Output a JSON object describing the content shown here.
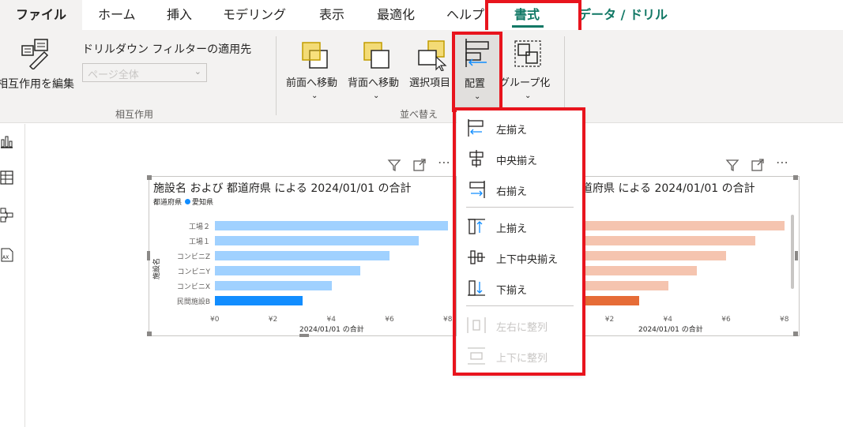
{
  "tabs": {
    "file": "ファイル",
    "home": "ホーム",
    "insert": "挿入",
    "modeling": "モデリング",
    "view": "表示",
    "optimize": "最適化",
    "help": "ヘルプ",
    "format": "書式",
    "data_drill": "データ / ドリル"
  },
  "ribbon": {
    "edit_interactions": "相互作用を編集",
    "drill_filter_label": "ドリルダウン フィルターの適用先",
    "drill_filter_value": "ページ全体",
    "group_interactions": "相互作用",
    "bring_forward": "前面へ移動",
    "send_backward": "背面へ移動",
    "selection_pane": "選択項目",
    "align": "配置",
    "group": "グループ化",
    "group_arrange": "並べ替え"
  },
  "visual_left": {
    "title": "施設名 および 都道府県 による 2024/01/01 の合計",
    "legend_label": "都道府県",
    "legend_item": "愛知県",
    "ylabel": "施設名",
    "xlabel": "2024/01/01 の合計"
  },
  "visual_right": {
    "title_visible": "道府県 による 2024/01/01 の合計",
    "xlabel": "2024/01/01 の合計"
  },
  "menu": {
    "align_left": "左揃え",
    "align_center": "中央揃え",
    "align_right": "右揃え",
    "align_top": "上揃え",
    "align_middle": "上下中央揃え",
    "align_bottom": "下揃え",
    "distribute_h": "左右に整列",
    "distribute_v": "上下に整列"
  },
  "colors": {
    "accent": "#117865",
    "annotation": "#e8141d",
    "bar_left": "#a0d1ff",
    "bar_left_highlight": "#118dff",
    "bar_right": "#f5c4af",
    "bar_right_highlight": "#e66c37"
  },
  "chart_data": [
    {
      "type": "bar",
      "orientation": "horizontal",
      "title": "施設名 および 都道府県 による 2024/01/01 の合計",
      "xlabel": "2024/01/01 の合計",
      "ylabel": "施設名",
      "categories": [
        "工場２",
        "工場１",
        "コンビニZ",
        "コンビニY",
        "コンビニX",
        "民間施設B"
      ],
      "values": [
        8,
        7,
        6,
        5,
        4,
        3
      ],
      "highlight_index": 5,
      "xticks": [
        "¥0",
        "¥2",
        "¥4",
        "¥6",
        "¥8"
      ],
      "xlim": [
        0,
        8
      ]
    },
    {
      "type": "bar",
      "orientation": "horizontal",
      "xlabel": "2024/01/01 の合計",
      "values": [
        8,
        7,
        6,
        5,
        4,
        3
      ],
      "highlight_index": 5,
      "xticks": [
        "¥2",
        "¥4",
        "¥6",
        "¥8"
      ],
      "xlim": [
        0,
        8
      ]
    }
  ]
}
